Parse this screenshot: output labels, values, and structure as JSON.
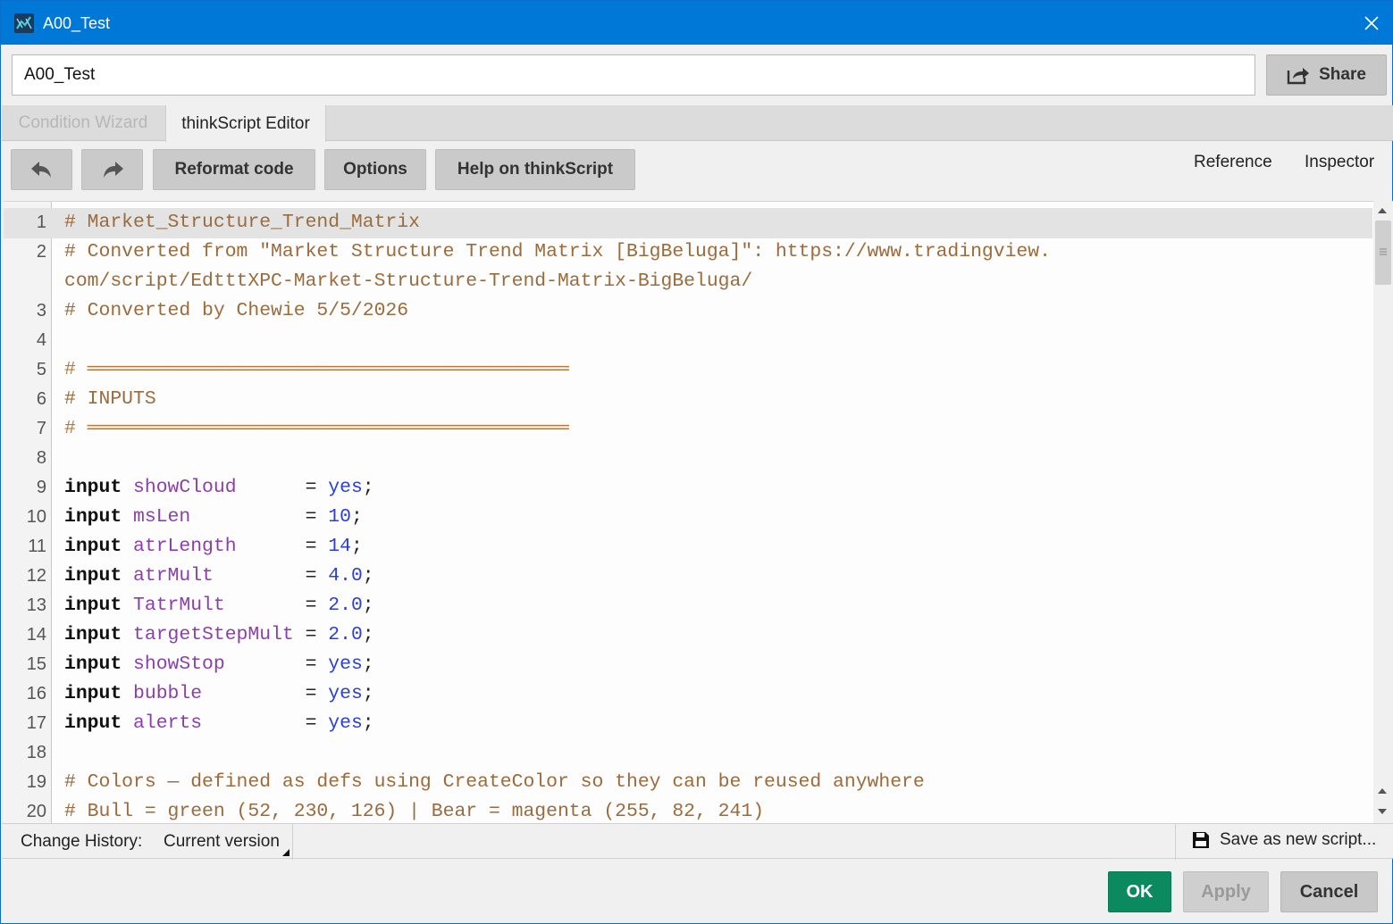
{
  "window": {
    "title": "A00_Test",
    "accent_color": "#0078d7"
  },
  "name_field": {
    "value": "A00_Test"
  },
  "share_button": {
    "label": "Share",
    "icon": "share-icon"
  },
  "tabs": [
    {
      "label": "Condition Wizard",
      "active": false
    },
    {
      "label": "thinkScript Editor",
      "active": true
    }
  ],
  "toolbar": {
    "undo_icon": "undo-icon",
    "redo_icon": "redo-icon",
    "reformat_label": "Reformat code",
    "options_label": "Options",
    "help_label": "Help on thinkScript",
    "reference_label": "Reference",
    "inspector_label": "Inspector"
  },
  "editor": {
    "lines": [
      {
        "n": "1",
        "text": "# Market_Structure_Trend_Matrix"
      },
      {
        "n": "2",
        "text": "# Converted from \"Market Structure Trend Matrix [BigBeluga]\": https://www.tradingview."
      },
      {
        "n": "",
        "text": "com/script/EdtttXPC-Market-Structure-Trend-Matrix-BigBeluga/"
      },
      {
        "n": "3",
        "text": "# Converted by Chewie 5/5/2026"
      },
      {
        "n": "4",
        "text": ""
      },
      {
        "n": "5",
        "text": "# ══════════════════════════════════════════"
      },
      {
        "n": "6",
        "text": "# INPUTS"
      },
      {
        "n": "7",
        "text": "# ══════════════════════════════════════════"
      },
      {
        "n": "8",
        "text": ""
      },
      {
        "n": "9",
        "kw": "input",
        "name": "showCloud      ",
        "value": "yes"
      },
      {
        "n": "10",
        "kw": "input",
        "name": "msLen          ",
        "value": "10"
      },
      {
        "n": "11",
        "kw": "input",
        "name": "atrLength      ",
        "value": "14"
      },
      {
        "n": "12",
        "kw": "input",
        "name": "atrMult        ",
        "value": "4.0"
      },
      {
        "n": "13",
        "kw": "input",
        "name": "TatrMult       ",
        "value": "2.0"
      },
      {
        "n": "14",
        "kw": "input",
        "name": "targetStepMult ",
        "value": "2.0"
      },
      {
        "n": "15",
        "kw": "input",
        "name": "showStop       ",
        "value": "yes"
      },
      {
        "n": "16",
        "kw": "input",
        "name": "bubble         ",
        "value": "yes"
      },
      {
        "n": "17",
        "kw": "input",
        "name": "alerts         ",
        "value": "yes"
      },
      {
        "n": "18",
        "text": ""
      },
      {
        "n": "19",
        "text": "# Colors — defined as defs using CreateColor so they can be reused anywhere"
      },
      {
        "n": "20",
        "text": "# Bull = green (52, 230, 126) | Bear = magenta (255, 82, 241)"
      }
    ]
  },
  "status": {
    "history_label": "Change History:",
    "history_value": "Current version",
    "save_new_label": "Save as new script..."
  },
  "footer": {
    "ok_label": "OK",
    "apply_label": "Apply",
    "cancel_label": "Cancel",
    "ok_color": "#0a8a5e"
  }
}
